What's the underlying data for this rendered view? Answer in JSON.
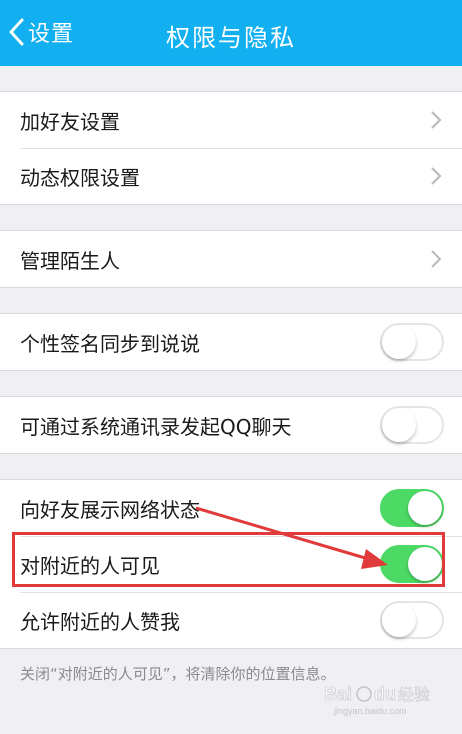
{
  "header": {
    "back_label": "设置",
    "title": "权限与隐私"
  },
  "groups": [
    {
      "rows": [
        {
          "label": "加好友设置",
          "control": "chevron"
        },
        {
          "label": "动态权限设置",
          "control": "chevron"
        }
      ]
    },
    {
      "rows": [
        {
          "label": "管理陌生人",
          "control": "chevron"
        }
      ]
    },
    {
      "rows": [
        {
          "label": "个性签名同步到说说",
          "control": "toggle",
          "on": false
        }
      ]
    },
    {
      "rows": [
        {
          "label": "可通过系统通讯录发起QQ聊天",
          "control": "toggle",
          "on": false
        }
      ]
    },
    {
      "rows": [
        {
          "label": "向好友展示网络状态",
          "control": "toggle",
          "on": true
        },
        {
          "label": "对附近的人可见",
          "control": "toggle",
          "on": true
        },
        {
          "label": "允许附近的人赞我",
          "control": "toggle",
          "on": false
        }
      ]
    }
  ],
  "footer_note": "关闭“对附近的人可见”，将清除你的位置信息。",
  "colors": {
    "header_bg": "#13b0f1",
    "toggle_on": "#4cd964",
    "annotation_red": "#e03a3a",
    "page_bg": "#efeff4"
  },
  "icons": {
    "back": "chevron-left-icon",
    "row_chevron": "chevron-right-icon"
  },
  "watermark": {
    "text": "Bai du 经验",
    "url": "jingyan.baidu.com"
  }
}
